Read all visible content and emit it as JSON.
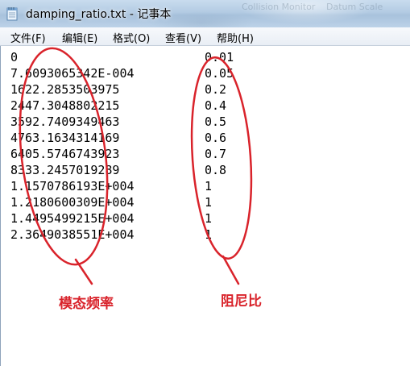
{
  "window": {
    "title": "damping_ratio.txt - 记事本",
    "background_ghost_text": [
      "Collision Monitor",
      "Datum Scale"
    ],
    "icon": "notepad-icon"
  },
  "menu": {
    "items": [
      {
        "label": "文件(F)"
      },
      {
        "label": "编辑(E)"
      },
      {
        "label": "格式(O)"
      },
      {
        "label": "查看(V)"
      },
      {
        "label": "帮助(H)"
      }
    ]
  },
  "content": {
    "rows": [
      {
        "frequency": "0",
        "damping": "0.01"
      },
      {
        "frequency": "7.6093065342E-004",
        "damping": "0.05"
      },
      {
        "frequency": "1622.2853503975",
        "damping": "0.2"
      },
      {
        "frequency": "2447.3048802215",
        "damping": "0.4"
      },
      {
        "frequency": "3592.7409349463",
        "damping": "0.5"
      },
      {
        "frequency": "4763.1634314169",
        "damping": "0.6"
      },
      {
        "frequency": "6405.5746743923",
        "damping": "0.7"
      },
      {
        "frequency": "8333.2457019289",
        "damping": "0.8"
      },
      {
        "frequency": "1.1570786193E+004",
        "damping": "1"
      },
      {
        "frequency": "1.2180600309E+004",
        "damping": "1"
      },
      {
        "frequency": "1.4495499215E+004",
        "damping": "1"
      },
      {
        "frequency": "2.3649038551E+004",
        "damping": "1"
      }
    ]
  },
  "annotations": {
    "frequency_label": "模态频率",
    "damping_label": "阻尼比",
    "color": "#d9232b"
  }
}
